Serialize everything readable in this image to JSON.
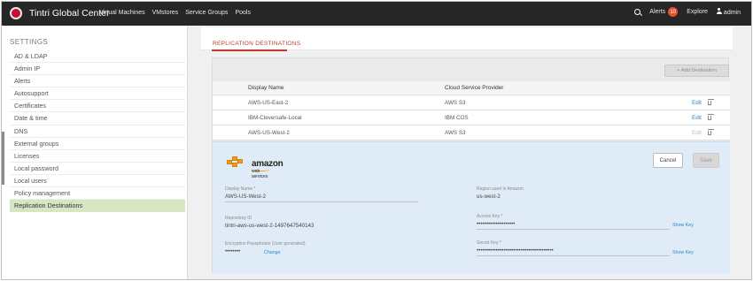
{
  "topbar": {
    "brand": "Tintri Global Center",
    "nav": [
      "Virtual Machines",
      "VMstores",
      "Service Groups",
      "Pools"
    ],
    "alerts_label": "Alerts",
    "alerts_count": "10",
    "explore_label": "Explore",
    "user_label": "admin"
  },
  "sidebar": {
    "title": "SETTINGS",
    "items": [
      {
        "label": "AD & LDAP"
      },
      {
        "label": "Admin IP"
      },
      {
        "label": "Alerts"
      },
      {
        "label": "Autosupport"
      },
      {
        "label": "Certificates"
      },
      {
        "label": "Date & time"
      },
      {
        "label": "DNS"
      },
      {
        "label": "External groups"
      },
      {
        "label": "Licenses"
      },
      {
        "label": "Local password"
      },
      {
        "label": "Local users"
      },
      {
        "label": "Policy management"
      },
      {
        "label": "Replication Destinations",
        "active": true
      }
    ]
  },
  "main": {
    "tab_label": "REPLICATION DESTINATIONS",
    "add_button": "+ Add Destination",
    "table": {
      "headers": [
        "Display Name",
        "Cloud Service Provider"
      ],
      "rows": [
        {
          "name": "AWS-US-East-2",
          "provider": "AWS S3",
          "edit": "Edit"
        },
        {
          "name": "IBM-Cleversafe-Local",
          "provider": "IBM COS",
          "edit": "Edit"
        },
        {
          "name": "AWS-US-West-2",
          "provider": "AWS S3",
          "edit": "Edit"
        }
      ]
    },
    "detail": {
      "logo_text": "amazon",
      "logo_subtext": "web services",
      "cancel_label": "Cancel",
      "save_label": "Save",
      "display_name_label": "Display Name *",
      "display_name_value": "AWS-US-West-2",
      "region_label": "Region used in Amazon",
      "region_value": "us-west-2",
      "repo_id_label": "Repository ID",
      "repo_id_value": "tintri-aws-us-west-2-1497647540143",
      "access_key_label": "Access Key *",
      "access_key_value": "••••••••••••••••••••",
      "show_key_label": "Show Key",
      "encryption_label": "Encryption Passphrase (User generated)",
      "encryption_value": "••••••••",
      "change_label": "Change",
      "secret_key_label": "Secret Key *",
      "secret_key_value": "••••••••••••••••••••••••••••••••••••••••"
    }
  },
  "colors": {
    "topbar_bg": "#262626",
    "accent_red": "#c0392b",
    "active_item_bg": "#d6e6c0",
    "link_blue": "#2e86c1",
    "detail_bg": "#dfecf8"
  },
  "icons": [
    "tintri-logo-icon",
    "search-icon",
    "user-icon",
    "trash-icon",
    "aws-logo"
  ]
}
